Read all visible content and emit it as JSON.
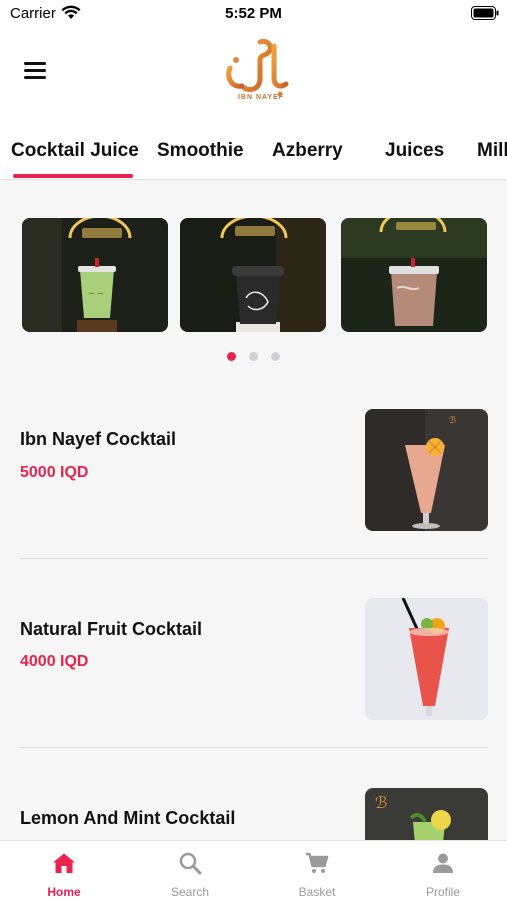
{
  "status_bar": {
    "carrier": "Carrier",
    "time": "5:52 PM"
  },
  "header": {
    "logo_caption": "IBN NAYEF",
    "menu_icon": "hamburger-menu-icon"
  },
  "tabs": [
    {
      "label": "Cocktail Juice",
      "active": true
    },
    {
      "label": "Smoothie",
      "active": false
    },
    {
      "label": "Azberry",
      "active": false
    },
    {
      "label": "Juices",
      "active": false
    },
    {
      "label": "Milk",
      "active": false
    }
  ],
  "carousel": {
    "slides": [
      "green-cup-drink",
      "black-cup-drink",
      "pink-cup-drink"
    ],
    "active_index": 0,
    "count": 3
  },
  "products": [
    {
      "name": "Ibn Nayef Cocktail",
      "price": "5000 IQD"
    },
    {
      "name": "Natural Fruit Cocktail",
      "price": "4000 IQD"
    },
    {
      "name": "Lemon And Mint Cocktail",
      "price": ""
    }
  ],
  "bottom_nav": [
    {
      "label": "Home",
      "icon": "home-icon",
      "active": true
    },
    {
      "label": "Search",
      "icon": "search-icon",
      "active": false
    },
    {
      "label": "Basket",
      "icon": "cart-icon",
      "active": false
    },
    {
      "label": "Profile",
      "icon": "profile-icon",
      "active": false
    }
  ],
  "colors": {
    "accent": "#e8234d",
    "logo": "#e08a3a",
    "background": "#f6f6f7"
  }
}
